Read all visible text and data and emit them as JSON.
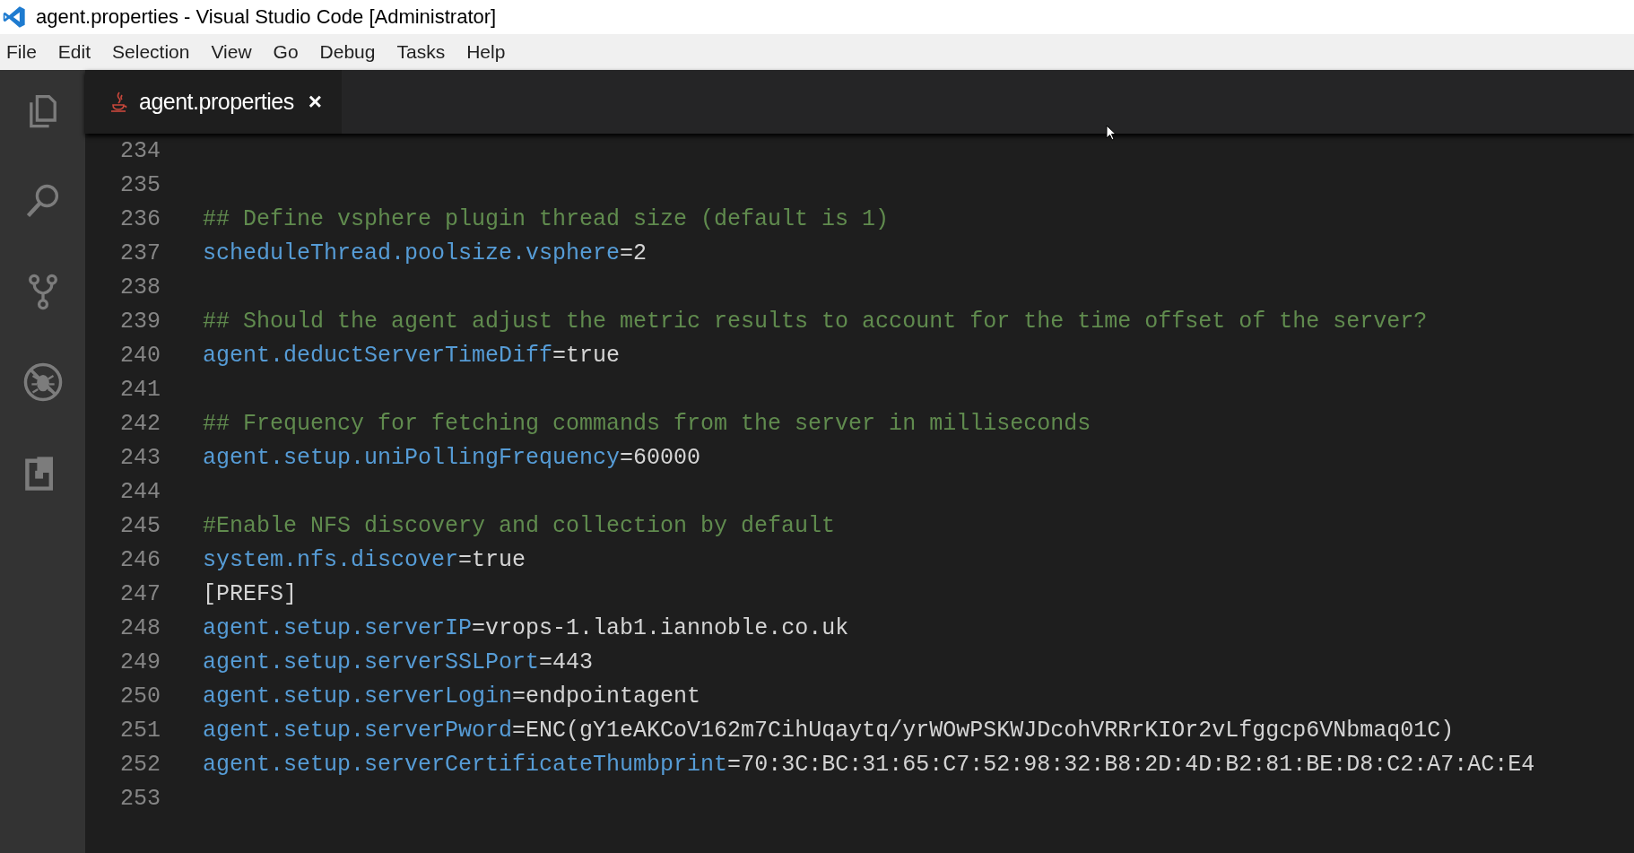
{
  "window": {
    "title": "agent.properties - Visual Studio Code [Administrator]"
  },
  "menu": [
    "File",
    "Edit",
    "Selection",
    "View",
    "Go",
    "Debug",
    "Tasks",
    "Help"
  ],
  "activity_bar": [
    {
      "kind": "files",
      "selected": false
    },
    {
      "kind": "search",
      "selected": false
    },
    {
      "kind": "scm",
      "selected": false
    },
    {
      "kind": "debug",
      "selected": false
    },
    {
      "kind": "extensions",
      "selected": false
    }
  ],
  "tabs": [
    {
      "label": "agent.properties",
      "close": "×",
      "selected": true
    }
  ],
  "editor": {
    "lines": [
      {
        "number": "234",
        "kind": "blank"
      },
      {
        "number": "235",
        "kind": "blank"
      },
      {
        "number": "236",
        "kind": "comment",
        "text": "## Define vsphere plugin thread size (default is 1)"
      },
      {
        "number": "237",
        "kind": "property",
        "key": "scheduleThread.poolsize.vsphere",
        "sep": "=",
        "value": "2"
      },
      {
        "number": "238",
        "kind": "blank"
      },
      {
        "number": "239",
        "kind": "comment",
        "text": "## Should the agent adjust the metric results to account for the time offset of the server?"
      },
      {
        "number": "240",
        "kind": "property",
        "key": "agent.deductServerTimeDiff",
        "sep": "=",
        "value": "true"
      },
      {
        "number": "241",
        "kind": "blank"
      },
      {
        "number": "242",
        "kind": "comment",
        "text": "## Frequency for fetching commands from the server in milliseconds"
      },
      {
        "number": "243",
        "kind": "property",
        "key": "agent.setup.uniPollingFrequency",
        "sep": "=",
        "value": "60000"
      },
      {
        "number": "244",
        "kind": "blank"
      },
      {
        "number": "245",
        "kind": "comment",
        "text": "#Enable NFS discovery and collection by default"
      },
      {
        "number": "246",
        "kind": "property",
        "key": "system.nfs.discover",
        "sep": "=",
        "value": "true"
      },
      {
        "number": "247",
        "kind": "section",
        "text": "[PREFS]"
      },
      {
        "number": "248",
        "kind": "property",
        "key": "agent.setup.serverIP",
        "sep": "=",
        "value": "vrops-1.lab1.iannoble.co.uk"
      },
      {
        "number": "249",
        "kind": "property",
        "key": "agent.setup.serverSSLPort",
        "sep": "=",
        "value": "443"
      },
      {
        "number": "250",
        "kind": "property",
        "key": "agent.setup.serverLogin",
        "sep": "=",
        "value": "endpointagent"
      },
      {
        "number": "251",
        "kind": "property",
        "key": "agent.setup.serverPword",
        "sep": "=",
        "value": "ENC(gY1eAKCoV162m7CihUqaytq/yrWOwPSKWJDcohVRRrKIOr2vLfggcp6VNbmaq01C)"
      },
      {
        "number": "252",
        "kind": "property",
        "key": "agent.setup.serverCertificateThumbprint",
        "sep": "=",
        "value": "70:3C:BC:31:65:C7:52:98:32:B8:2D:4D:B2:81:BE:D8:C2:A7:AC:E4"
      },
      {
        "number": "253",
        "kind": "blank"
      }
    ]
  }
}
